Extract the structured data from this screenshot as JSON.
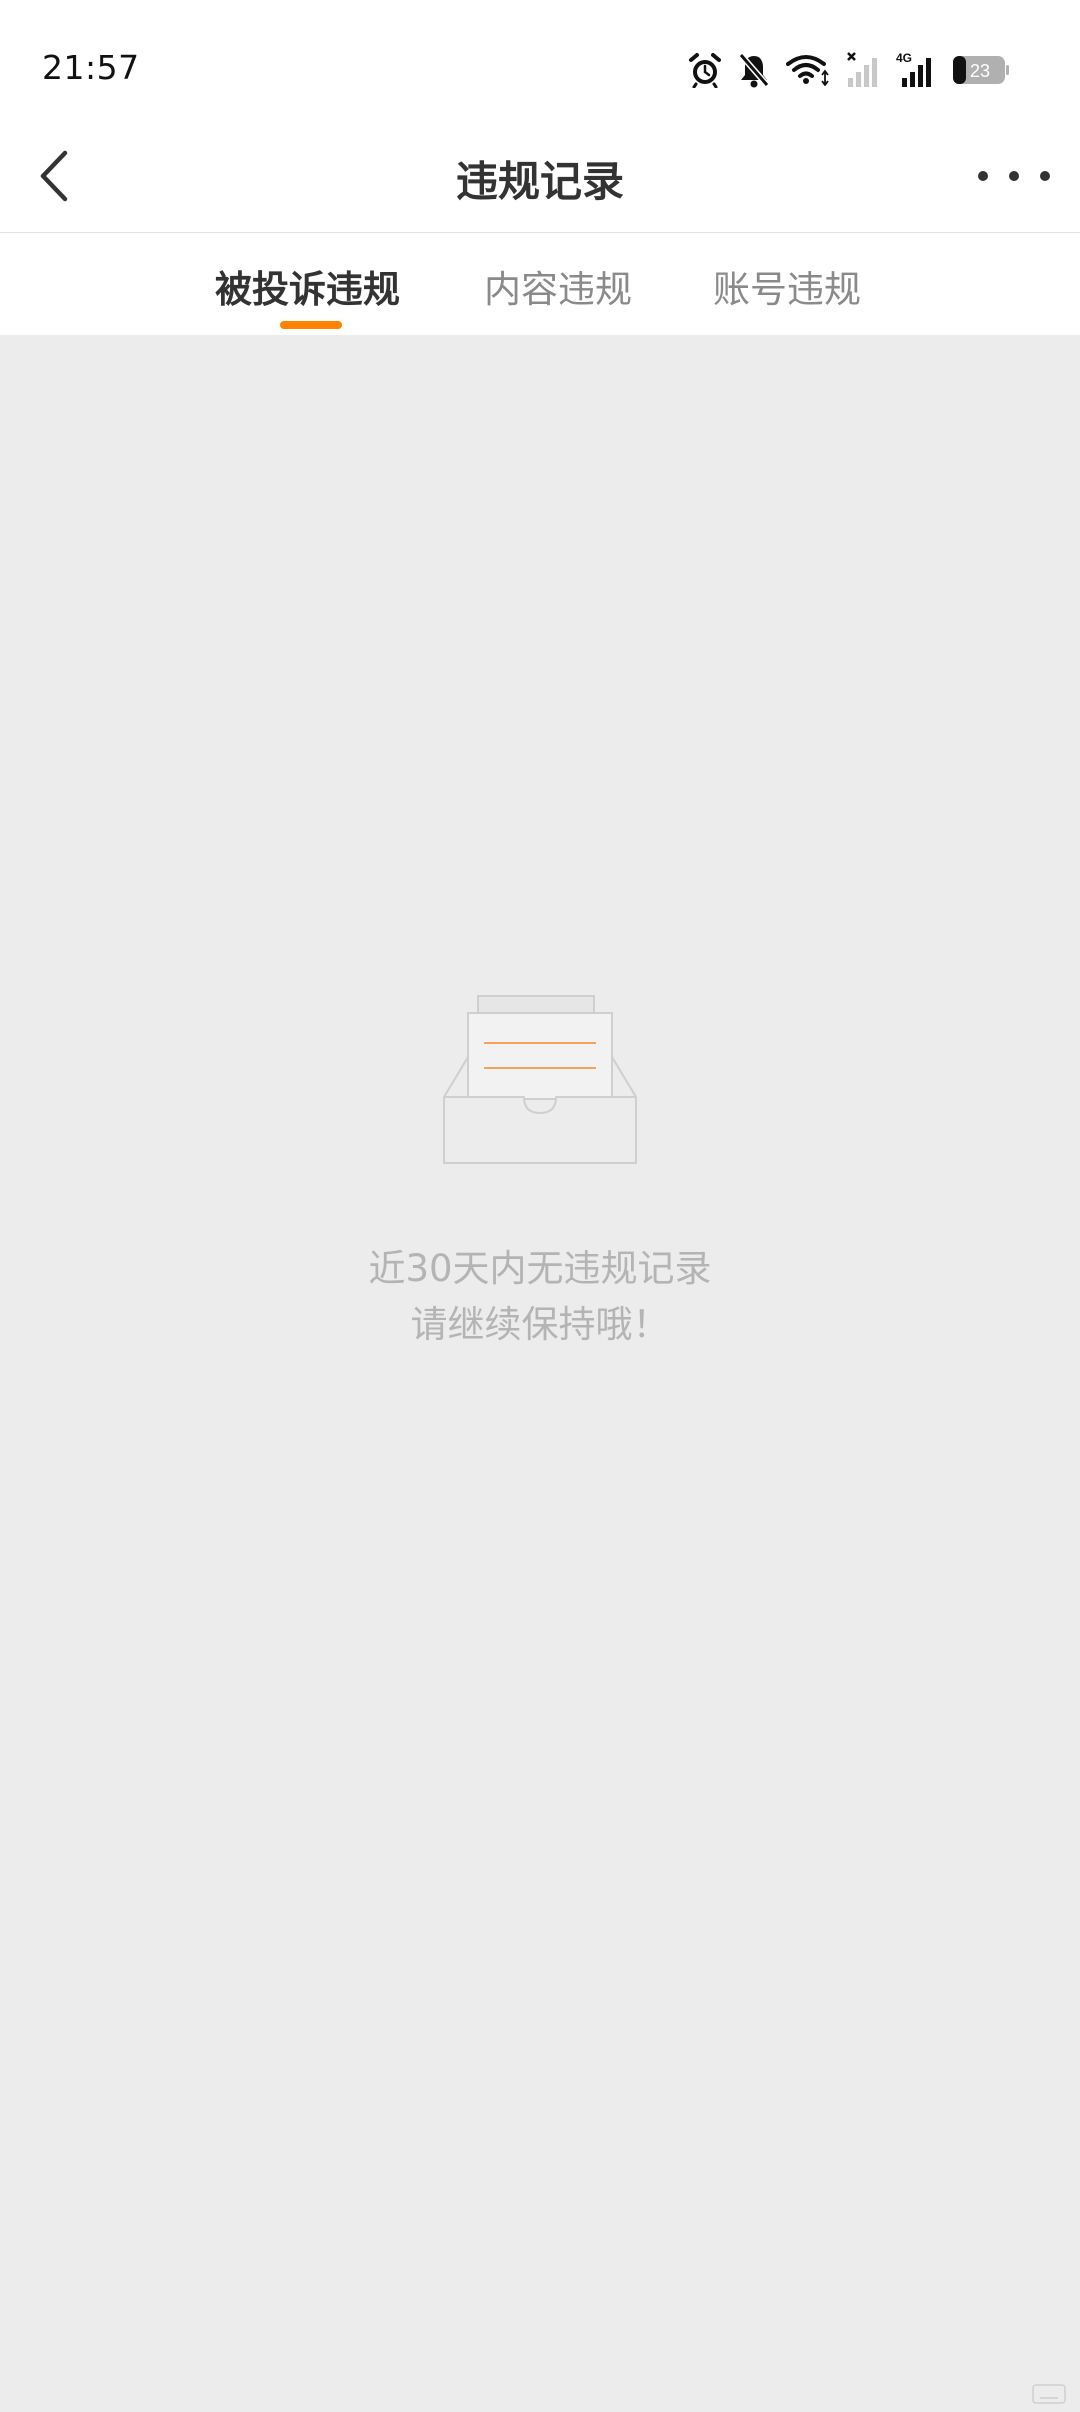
{
  "status_bar": {
    "time": "21:57",
    "network_type": "4G",
    "battery_level": "23",
    "icons": [
      "alarm-icon",
      "bell-off-icon",
      "wifi-icon",
      "signal-no-service-icon",
      "signal-4g-icon",
      "battery-icon"
    ]
  },
  "nav": {
    "title": "违规记录",
    "back_icon": "chevron-left-icon",
    "more_icon": "more-dots-icon"
  },
  "tabs": [
    {
      "label": "被投诉违规",
      "active": true
    },
    {
      "label": "内容违规",
      "active": false
    },
    {
      "label": "账号违规",
      "active": false
    }
  ],
  "empty_state": {
    "icon": "empty-inbox-icon",
    "line1": "近30天内无违规记录",
    "line2": "请继续保持哦！"
  },
  "colors": {
    "accent": "#ff8200",
    "background": "#ececec",
    "header_bg": "#ffffff",
    "title_text": "#333333",
    "inactive_tab_text": "#8a8a8a",
    "empty_text": "#b4b4b4"
  }
}
